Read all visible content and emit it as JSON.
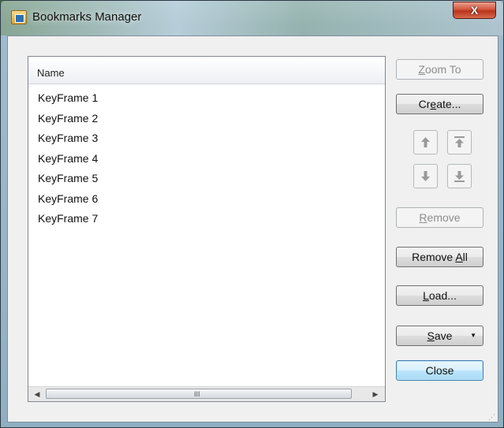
{
  "window": {
    "title": "Bookmarks Manager",
    "close_label": "X"
  },
  "list": {
    "column_header": "Name",
    "items": [
      "KeyFrame 1",
      "KeyFrame 2",
      "KeyFrame 3",
      "KeyFrame 4",
      "KeyFrame 5",
      "KeyFrame 6",
      "KeyFrame 7"
    ],
    "scroll_grip": "III"
  },
  "buttons": {
    "zoom_to": {
      "u": "Z",
      "rest": "oom To",
      "enabled": false
    },
    "create": {
      "pre": "Cr",
      "u": "e",
      "rest": "ate...",
      "enabled": true
    },
    "remove": {
      "u": "R",
      "rest": "emove",
      "enabled": false
    },
    "remove_all": {
      "pre": "Remove ",
      "u": "A",
      "rest": "ll",
      "enabled": true
    },
    "load": {
      "u": "L",
      "rest": "oad...",
      "enabled": true
    },
    "save": {
      "u": "S",
      "rest": "ave",
      "enabled": true
    },
    "close": {
      "label": "Close",
      "enabled": true
    }
  },
  "icons": {
    "move_up": "arrow-up-icon",
    "move_to_top": "arrow-to-top-icon",
    "move_down": "arrow-down-icon",
    "move_to_bottom": "arrow-to-bottom-icon",
    "scroll_left": "chevron-left-icon",
    "scroll_right": "chevron-right-icon",
    "resize_grip": "resize-grip-icon"
  },
  "colors": {
    "default_button_border": "#3c7fb1",
    "disabled_text": "#8d8d8d",
    "close_button": "#c7432a"
  }
}
